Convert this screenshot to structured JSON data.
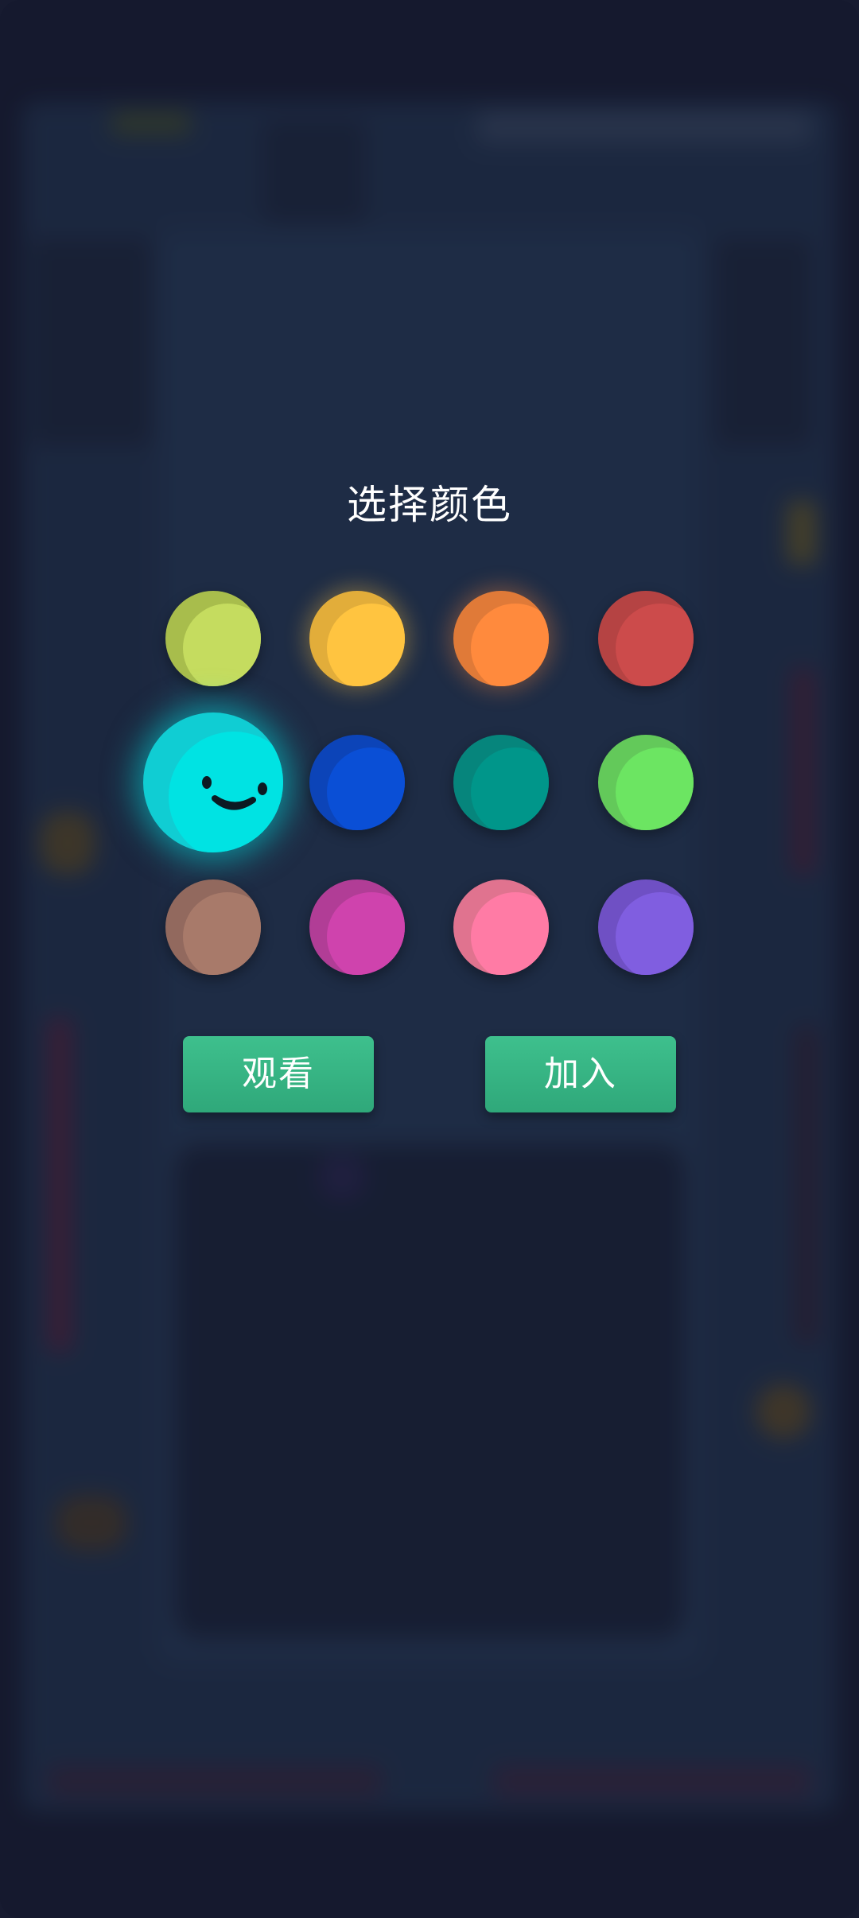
{
  "dialog": {
    "title": "选择颜色",
    "watch_label": "观看",
    "join_label": "加入"
  },
  "colors": [
    {
      "name": "lime",
      "hex": "#c5dc5f",
      "shade": "#a8bd4c",
      "glow": false,
      "selected": false
    },
    {
      "name": "yellow",
      "hex": "#ffc440",
      "shade": "#e2ad3a",
      "glow": true,
      "selected": false
    },
    {
      "name": "orange",
      "hex": "#ff8a3d",
      "shade": "#e07a38",
      "glow": true,
      "selected": false
    },
    {
      "name": "red",
      "hex": "#cc4b4b",
      "shade": "#b54343",
      "glow": false,
      "selected": false
    },
    {
      "name": "cyan",
      "hex": "#00e3e3",
      "shade": "#10cdd3",
      "glow": true,
      "selected": true
    },
    {
      "name": "blue",
      "hex": "#0a4fd6",
      "shade": "#0c44b8",
      "glow": false,
      "selected": false
    },
    {
      "name": "teal",
      "hex": "#00968a",
      "shade": "#06857c",
      "glow": false,
      "selected": false
    },
    {
      "name": "green",
      "hex": "#6ce562",
      "shade": "#63c95a",
      "glow": false,
      "selected": false
    },
    {
      "name": "brown",
      "hex": "#a87a6a",
      "shade": "#92695e",
      "glow": false,
      "selected": false
    },
    {
      "name": "magenta",
      "hex": "#cf43ad",
      "shade": "#b13d96",
      "glow": false,
      "selected": false
    },
    {
      "name": "pink",
      "hex": "#ff7ba5",
      "shade": "#e0738f",
      "glow": false,
      "selected": false
    },
    {
      "name": "purple",
      "hex": "#805ee0",
      "shade": "#6f50c4",
      "glow": false,
      "selected": false
    }
  ],
  "theme": {
    "background": "#171b30",
    "button_green": "#35b381",
    "title_color": "#ffffff"
  }
}
